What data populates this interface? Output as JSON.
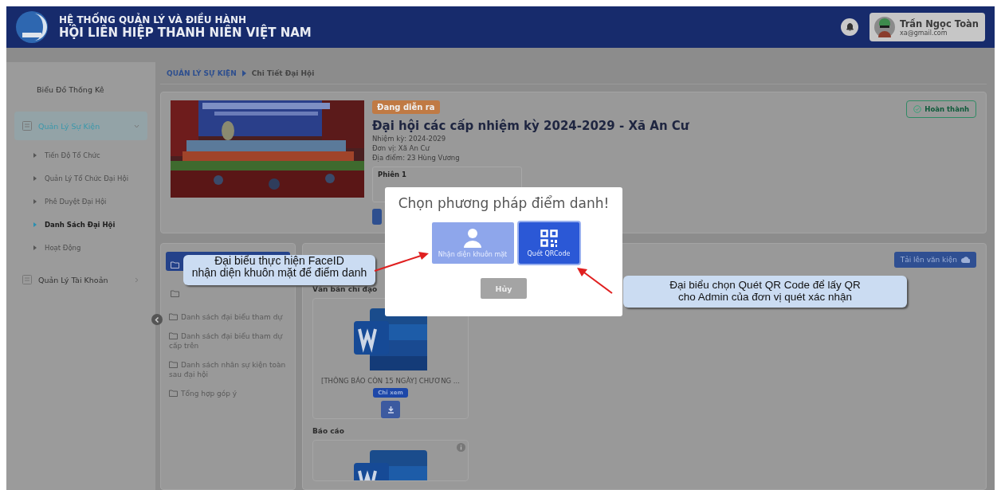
{
  "header": {
    "title_line1": "HỆ THỐNG QUẢN LÝ VÀ ĐIỀU HÀNH",
    "title_line2": "HỘI LIÊN HIỆP THANH NIÊN VIỆT NAM",
    "user": {
      "name": "Trần Ngọc Toàn",
      "email": "xa@gmail.com"
    }
  },
  "sidebar": {
    "items": [
      {
        "label": "Biểu Đồ Thống Kê",
        "kind": "plain",
        "selected": false
      },
      {
        "label": "Quản Lý Sự Kiện",
        "kind": "group",
        "selected": true,
        "expanded": true,
        "children": [
          {
            "label": "Tiến Độ Tổ Chức",
            "selected": false
          },
          {
            "label": "Quản Lý Tổ Chức Đại Hội",
            "selected": false
          },
          {
            "label": "Phê Duyệt Đại Hội",
            "selected": false
          },
          {
            "label": "Danh Sách Đại Hội",
            "selected": true
          },
          {
            "label": "Hoạt Động",
            "selected": false
          }
        ]
      },
      {
        "label": "Quản Lý Tài Khoản",
        "kind": "group",
        "selected": false,
        "expanded": false
      }
    ]
  },
  "breadcrumb": [
    "QUẢN LÝ SỰ KIỆN",
    "Chi Tiết Đại Hội"
  ],
  "event": {
    "status": "Đang diễn ra",
    "title": "Đại hội các cấp nhiệm kỳ 2024-2029 - Xã An Cư",
    "details": [
      "Nhiệm kỳ: 2024-2029",
      "Đơn vị: Xã An Cư",
      "Địa điểm: 23 Hùng Vương"
    ],
    "session": "Phiên 1",
    "complete_button": "Hoàn thành"
  },
  "documents": {
    "hidden_folders": [
      {
        "selected": true
      },
      {
        "selected": false
      }
    ],
    "folders": [
      {
        "label": "Danh sách đại biểu tham dự",
        "selected": false
      },
      {
        "label": "Danh sách đại biểu tham dự cấp trên",
        "selected": false
      },
      {
        "label": "Danh sách nhân sự kiện toàn sau đại hội",
        "selected": false
      },
      {
        "label": "Tổng hợp góp ý",
        "selected": false
      }
    ],
    "upload_button": "Tải lên văn kiện",
    "sections": [
      {
        "title": "Văn bản chỉ đạo",
        "files": [
          {
            "name": "[THÔNG BÁO CÒN 15 NGÀY] CHƯƠNG ...",
            "badge": "Chỉ xem"
          }
        ]
      },
      {
        "title": "Báo cáo",
        "files": [
          {
            "kind": "partial"
          }
        ]
      }
    ]
  },
  "modal": {
    "title": "Chọn phương pháp điểm danh!",
    "options": [
      {
        "kind": "face",
        "label": "Nhận diện khuôn mặt",
        "selected": false
      },
      {
        "kind": "qr",
        "label": "Quét QRCode",
        "selected": true
      }
    ],
    "cancel": "Hủy"
  },
  "callouts": [
    {
      "text": "Đại biểu thực hiện FaceID\nnhận diện khuôn mặt để điểm danh"
    },
    {
      "text": "Đại biểu chọn Quét QR  Code để lấy QR\ncho Admin của đơn vị quét xác nhận"
    }
  ]
}
